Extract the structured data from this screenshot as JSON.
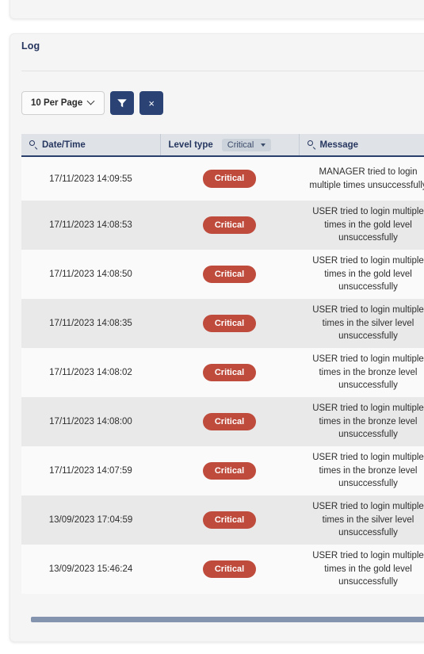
{
  "card": {
    "title": "Log"
  },
  "toolbar": {
    "per_page_label": "10 Per Page",
    "filter_icon": "filter-funnel-icon",
    "clear_label": "×",
    "button_color": "#2a4374"
  },
  "table": {
    "columns": [
      {
        "key": "datetime",
        "label": "Date/Time",
        "icon": "search-icon"
      },
      {
        "key": "level",
        "label": "Level type",
        "filter_value": "Critical"
      },
      {
        "key": "message",
        "label": "Message",
        "icon": "search-icon"
      }
    ],
    "badge_color": "#bf4b3c",
    "rows": [
      {
        "datetime": "17/11/2023 14:09:55",
        "level": "Critical",
        "message": "MANAGER tried to login multiple times unsuccessfully"
      },
      {
        "datetime": "17/11/2023 14:08:53",
        "level": "Critical",
        "message": "USER tried to login multiple times in the gold level unsuccessfully"
      },
      {
        "datetime": "17/11/2023 14:08:50",
        "level": "Critical",
        "message": "USER tried to login multiple times in the gold level unsuccessfully"
      },
      {
        "datetime": "17/11/2023 14:08:35",
        "level": "Critical",
        "message": "USER tried to login multiple times in the silver level unsuccessfully"
      },
      {
        "datetime": "17/11/2023 14:08:02",
        "level": "Critical",
        "message": "USER tried to login multiple times in the bronze level unsuccessfully"
      },
      {
        "datetime": "17/11/2023 14:08:00",
        "level": "Critical",
        "message": "USER tried to login multiple times in the bronze level unsuccessfully"
      },
      {
        "datetime": "17/11/2023 14:07:59",
        "level": "Critical",
        "message": "USER tried to login multiple times in the bronze level unsuccessfully"
      },
      {
        "datetime": "13/09/2023 17:04:59",
        "level": "Critical",
        "message": "USER tried to login multiple times in the silver level unsuccessfully"
      },
      {
        "datetime": "13/09/2023 15:46:24",
        "level": "Critical",
        "message": "USER tried to login multiple times in the gold level unsuccessfully"
      }
    ]
  },
  "scrollbar": {
    "orientation": "horizontal",
    "thumb_color": "#8494ae"
  }
}
